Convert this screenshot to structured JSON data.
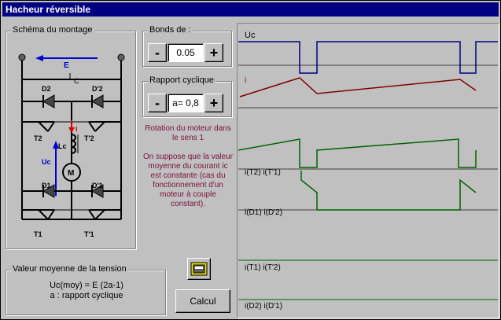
{
  "window": {
    "title": "Hacheur réversible"
  },
  "schema": {
    "label": "Schéma du montage",
    "E": "E",
    "C": "C",
    "i": "i",
    "Lc": "Lc",
    "Uc": "Uc",
    "M": "M",
    "D2": "D2",
    "D2p": "D'2",
    "T2": "T2",
    "T2p": "T'2",
    "D1": "D1",
    "D1p": "D'1",
    "T1": "T1",
    "T1p": "T'1"
  },
  "bonds": {
    "label": "Bonds de :",
    "minus": "-",
    "value": "0.05",
    "plus": "+"
  },
  "rapport": {
    "label": "Rapport cyclique",
    "minus": "-",
    "value": "a= 0,8",
    "plus": "+"
  },
  "note": {
    "line1": "Rotation du moteur dans le sens 1",
    "line2": "On suppose que la valeur moyenne du courant  ic  est constante (cas du fonctionnement d'un moteur à couple constant)."
  },
  "tension": {
    "label": "Valeur moyenne de la tension",
    "formula": "Uc(moy) =  E  (2a-1)",
    "legend": "a : rapport cyclique"
  },
  "buttons": {
    "calcul": "Calcul"
  },
  "scope": {
    "uc": "Uc",
    "i": "i",
    "it2": "i(T2) i(T'1)",
    "id1": "i(D1) i(D'2)",
    "it1": "i(T1) i(T'2)",
    "id2": "i(D2) i(D'1)"
  },
  "colors": {
    "title_bg": "#000080",
    "uc_trace": "#000080",
    "i_trace": "#800000",
    "current_trace": "#006400",
    "note_text": "#7a0f3a"
  },
  "icons": {
    "calculate": "calculator-icon"
  }
}
